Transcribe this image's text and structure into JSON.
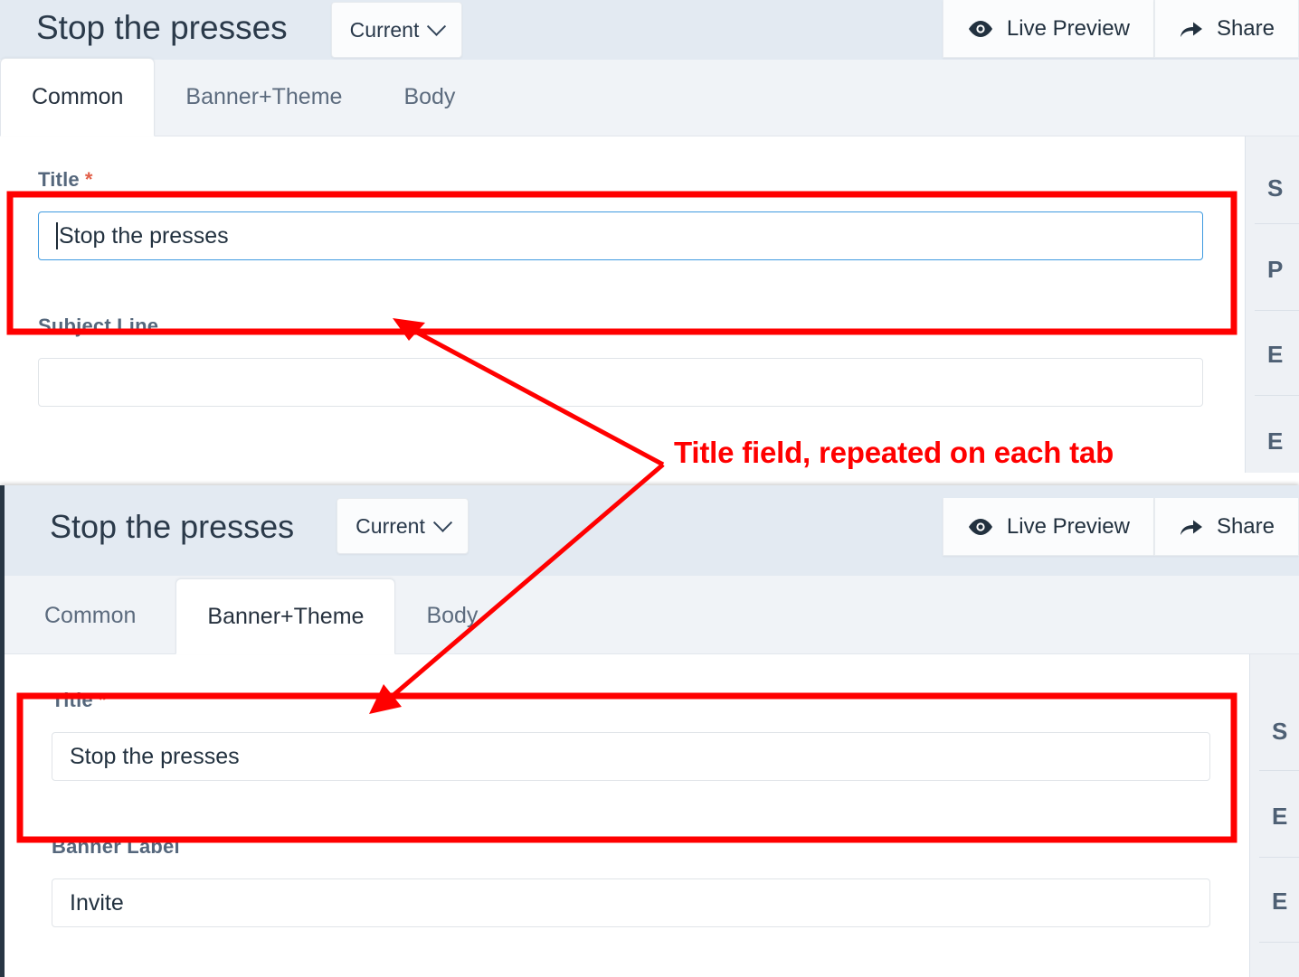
{
  "accent": {
    "annotation_red": "#ff0000",
    "focus_blue": "#3e9ae0",
    "required_red": "#e2604a",
    "header_bg": "#e3eaf2",
    "tabstrip_bg": "#f0f3f7",
    "rail_bg": "#eef1f5",
    "text_dark": "#22313f",
    "label_gray": "#55677c"
  },
  "panel_one": {
    "doc_title": "Stop the presses",
    "version_button": {
      "label": "Current",
      "icon": "chevron-down-icon"
    },
    "actions": [
      {
        "label": "Live Preview",
        "icon": "eye-icon"
      },
      {
        "label": "Share",
        "icon": "share-arrow-icon"
      }
    ],
    "tabs": [
      {
        "label": "Common",
        "active": true
      },
      {
        "label": "Banner+Theme",
        "active": false
      },
      {
        "label": "Body",
        "active": false
      }
    ],
    "fields": [
      {
        "label": "Title",
        "required_marker": "*",
        "value": "Stop the presses",
        "placeholder": "",
        "focused": true
      },
      {
        "label": "Subject Line",
        "required_marker": "",
        "value": "",
        "placeholder": "",
        "focused": false
      }
    ],
    "side_rail": [
      {
        "text": "S"
      },
      {
        "text": "P"
      },
      {
        "text": "E"
      },
      {
        "text": "E"
      }
    ]
  },
  "panel_two": {
    "doc_title": "Stop the presses",
    "version_button": {
      "label": "Current",
      "icon": "chevron-down-icon"
    },
    "actions": [
      {
        "label": "Live Preview",
        "icon": "eye-icon"
      },
      {
        "label": "Share",
        "icon": "share-arrow-icon"
      }
    ],
    "tabs": [
      {
        "label": "Common",
        "active": false
      },
      {
        "label": "Banner+Theme",
        "active": true
      },
      {
        "label": "Body",
        "active": false
      }
    ],
    "fields": [
      {
        "label": "Title",
        "required_marker": "*",
        "value": "Stop the presses",
        "placeholder": "",
        "focused": false
      },
      {
        "label": "Banner Label",
        "required_marker": "",
        "value": "Invite",
        "placeholder": "",
        "focused": false
      }
    ],
    "side_rail": [
      {
        "text": "S"
      },
      {
        "text": "E"
      },
      {
        "text": "E"
      }
    ]
  },
  "annotation": {
    "callout_text": "Title field, repeated on each tab",
    "color": "#ff0000"
  }
}
